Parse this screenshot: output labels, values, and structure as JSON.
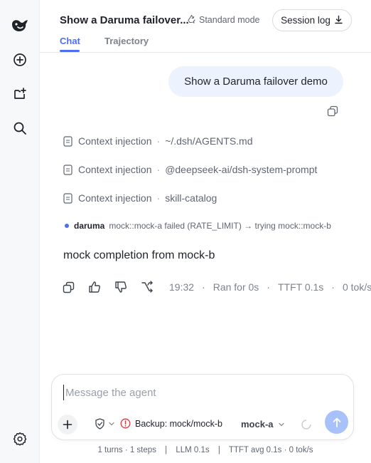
{
  "app": {
    "title": "Show a Daruma failover...",
    "mode_label": "Standard mode",
    "session_log_label": "Session log"
  },
  "tabs": [
    {
      "label": "Chat",
      "active": true
    },
    {
      "label": "Trajectory",
      "active": false
    }
  ],
  "sidebar": {
    "icons": [
      "whale-logo-icon",
      "new-chat-icon",
      "add-project-icon",
      "search-icon",
      "settings-icon"
    ]
  },
  "chat": {
    "user_message": "Show a Daruma failover demo",
    "context_injections": [
      {
        "label": "Context injection",
        "source": "~/.dsh/AGENTS.md"
      },
      {
        "label": "Context injection",
        "source": "@deepseek-ai/dsh-system-prompt"
      },
      {
        "label": "Context injection",
        "source": "skill-catalog"
      }
    ],
    "failover": {
      "name": "daruma",
      "message": "mock::mock-a failed (RATE_LIMIT) → trying mock::mock-b"
    },
    "assistant_message": "mock completion from mock-b",
    "meta": {
      "time": "19:32",
      "ran_for": "Ran for 0s",
      "ttft": "TTFT 0.1s",
      "tokens": "0 tok/s"
    }
  },
  "composer": {
    "placeholder": "Message the agent",
    "value": "",
    "backup_label": "Backup: mock/mock-b",
    "model": "mock-a"
  },
  "footer": {
    "steps": "1 turns · 1 steps",
    "llm": "LLM 0.1s",
    "ttft_avg": "TTFT avg 0.1s · 0 tok/s"
  },
  "colors": {
    "accent": "#4e6ef2",
    "user_bubble": "#edf3fe",
    "send_button": "#a9c1fb",
    "warning": "#d9363e"
  }
}
